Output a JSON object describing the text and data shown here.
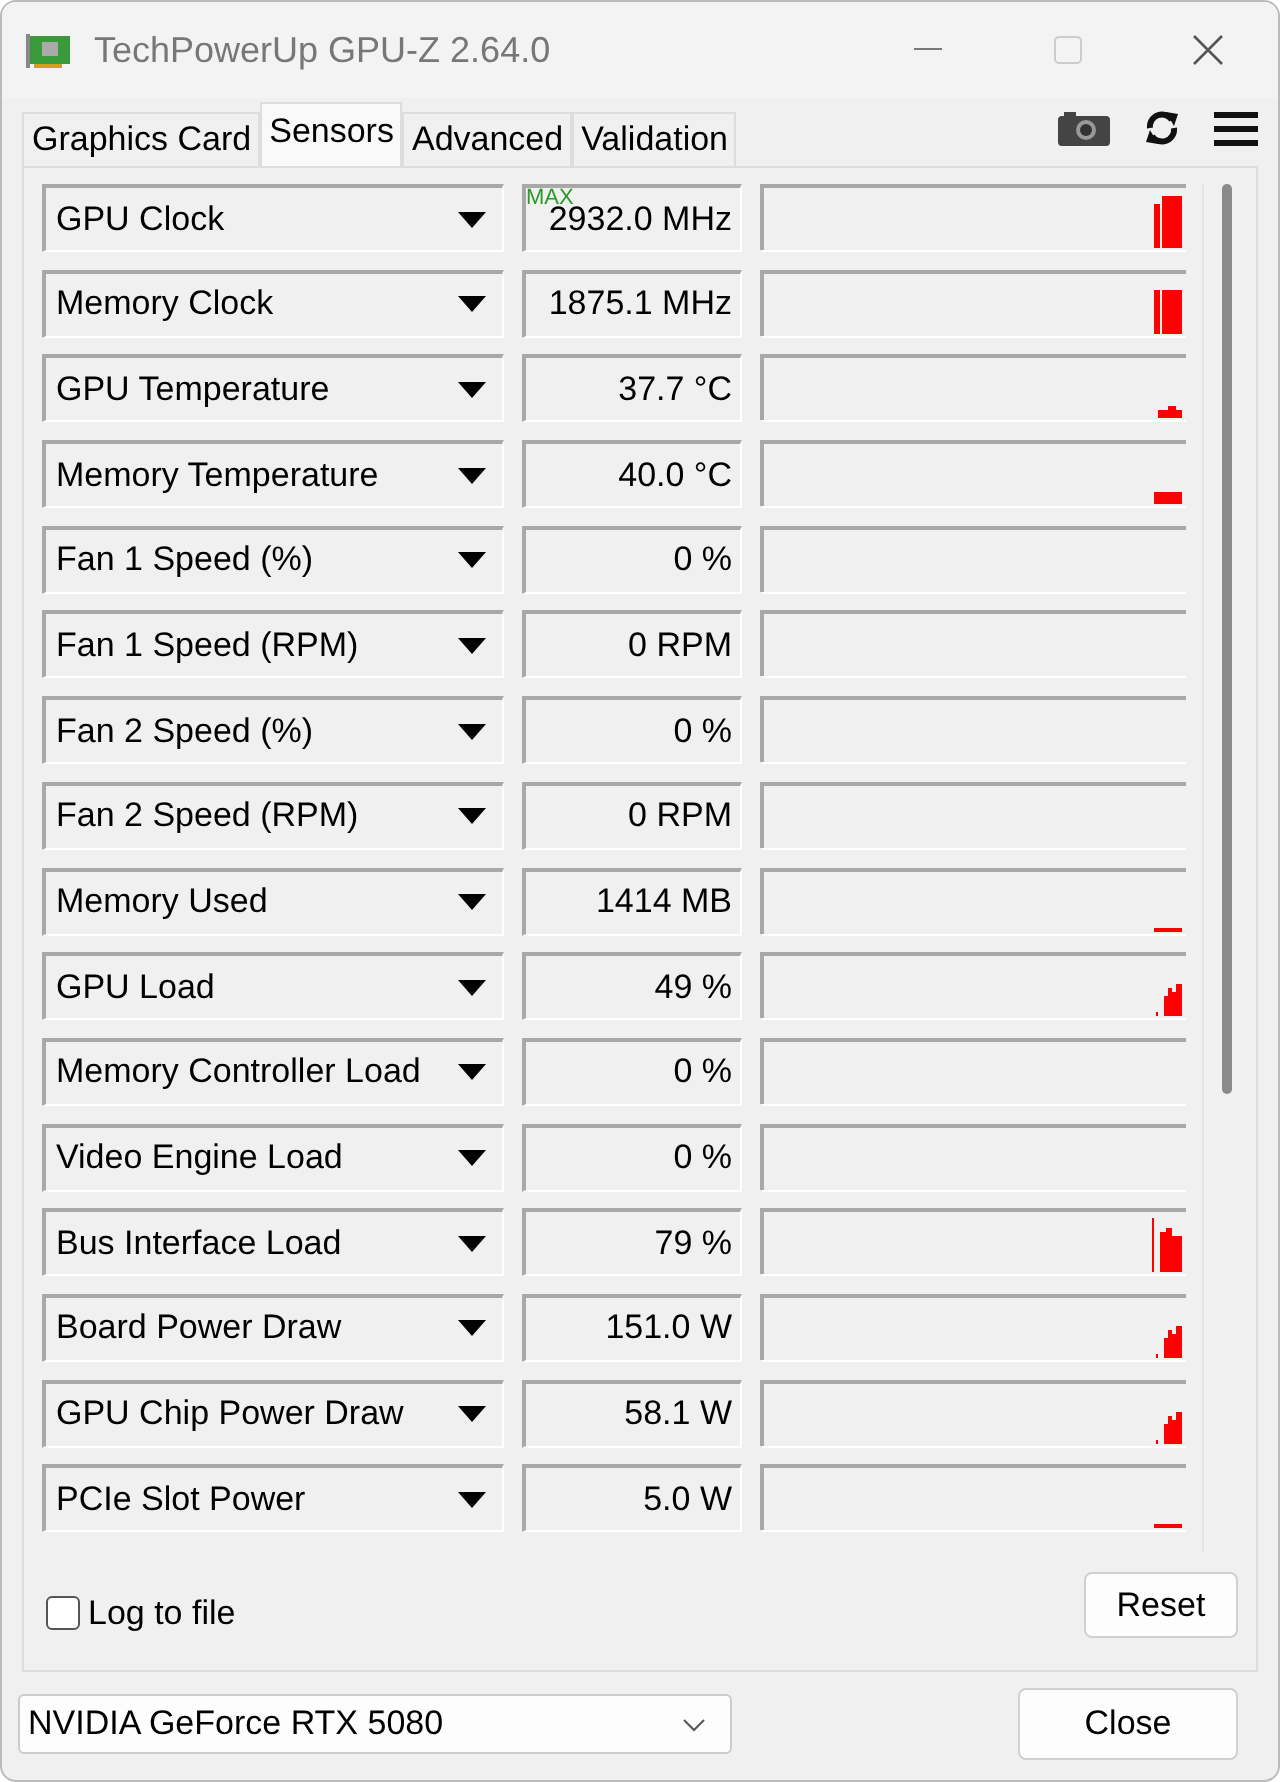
{
  "window": {
    "title": "TechPowerUp GPU-Z 2.64.0"
  },
  "tabs": [
    {
      "label": "Graphics Card",
      "selected": false
    },
    {
      "label": "Sensors",
      "selected": true
    },
    {
      "label": "Advanced",
      "selected": false
    },
    {
      "label": "Validation",
      "selected": false
    }
  ],
  "sensors": [
    {
      "name": "GPU Clock",
      "badge": "MAX",
      "value": "2932.0 MHz",
      "kind": "tall"
    },
    {
      "name": "Memory Clock",
      "value": "1875.1 MHz",
      "kind": "block"
    },
    {
      "name": "GPU Temperature",
      "value": "37.7 °C",
      "kind": "bump"
    },
    {
      "name": "Memory Temperature",
      "value": "40.0 °C",
      "kind": "low"
    },
    {
      "name": "Fan 1 Speed (%)",
      "value": "0 %",
      "kind": "none"
    },
    {
      "name": "Fan 1 Speed (RPM)",
      "value": "0 RPM",
      "kind": "none"
    },
    {
      "name": "Fan 2 Speed (%)",
      "value": "0 %",
      "kind": "none"
    },
    {
      "name": "Fan 2 Speed (RPM)",
      "value": "0 RPM",
      "kind": "none"
    },
    {
      "name": "Memory Used",
      "value": "1414 MB",
      "kind": "line"
    },
    {
      "name": "GPU Load",
      "value": "49 %",
      "kind": "ramp"
    },
    {
      "name": "Memory Controller Load",
      "value": "0 %",
      "kind": "none"
    },
    {
      "name": "Video Engine Load",
      "value": "0 %",
      "kind": "none"
    },
    {
      "name": "Bus Interface Load",
      "value": "79 %",
      "kind": "spike"
    },
    {
      "name": "Board Power Draw",
      "value": "151.0 W",
      "kind": "ramp"
    },
    {
      "name": "GPU Chip Power Draw",
      "value": "58.1 W",
      "kind": "ramp"
    },
    {
      "name": "PCIe Slot Power",
      "value": "5.0 W",
      "kind": "line"
    }
  ],
  "log_to_file": {
    "label": "Log to file",
    "checked": false
  },
  "reset_button": "Reset",
  "gpu_select": {
    "value": "NVIDIA GeForce RTX 5080"
  },
  "close_button": "Close"
}
